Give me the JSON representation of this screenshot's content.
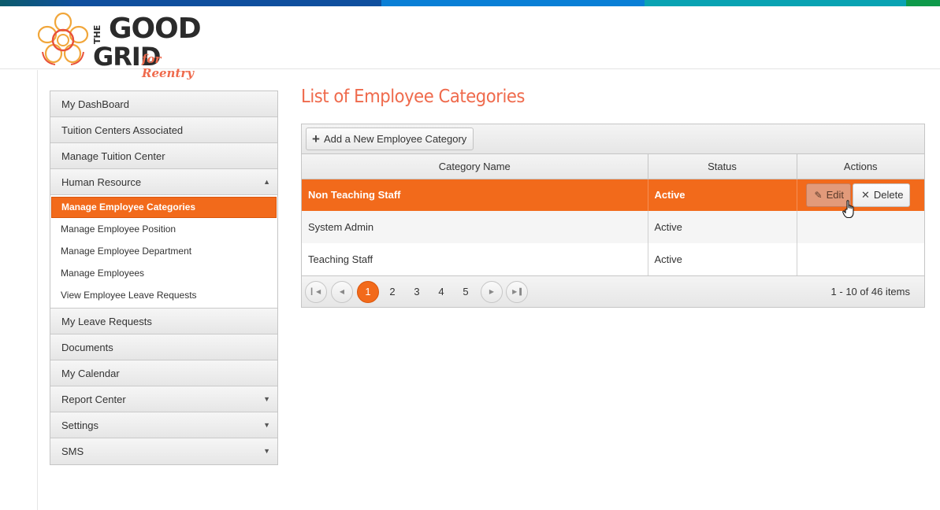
{
  "colors": {
    "accent": "#f26a1b",
    "title": "#ef6a4c",
    "stripe": [
      "#0c5b6b",
      "#0f4f9e",
      "#0a7fd6",
      "#0aa3b3",
      "#0e9a4a"
    ]
  },
  "logo": {
    "the": "THE",
    "good": "GOOD",
    "grid": "GRID",
    "tagline": "for Reentry"
  },
  "sidebar": {
    "items": [
      {
        "label": "My DashBoard"
      },
      {
        "label": "Tuition Centers Associated"
      },
      {
        "label": "Manage Tuition Center"
      },
      {
        "label": "Human Resource",
        "icon": "chevron-up-icon"
      }
    ],
    "hr_sub": [
      {
        "label": "Manage Employee Categories",
        "active": true
      },
      {
        "label": "Manage Employee Position"
      },
      {
        "label": "Manage Employee Department"
      },
      {
        "label": "Manage Employees"
      },
      {
        "label": "View Employee Leave Requests"
      }
    ],
    "items_after": [
      {
        "label": "My Leave Requests"
      },
      {
        "label": "Documents"
      },
      {
        "label": "My Calendar"
      },
      {
        "label": "Report Center",
        "icon": "chevron-down-icon"
      },
      {
        "label": "Settings",
        "icon": "chevron-down-icon"
      },
      {
        "label": "SMS",
        "icon": "chevron-down-icon"
      }
    ]
  },
  "main": {
    "title": "List of Employee Categories",
    "add_button": "Add a New Employee Category",
    "columns": [
      "Category Name",
      "Status",
      "Actions"
    ],
    "rows": [
      {
        "name": "Non Teaching Staff",
        "status": "Active",
        "selected": true
      },
      {
        "name": "System Admin",
        "status": "Active"
      },
      {
        "name": "Teaching Staff",
        "status": "Active"
      }
    ],
    "actions": {
      "edit": "Edit",
      "delete": "Delete"
    },
    "pager": {
      "pages": [
        "1",
        "2",
        "3",
        "4",
        "5"
      ],
      "current": "1",
      "info": "1 - 10 of 46 items"
    }
  }
}
